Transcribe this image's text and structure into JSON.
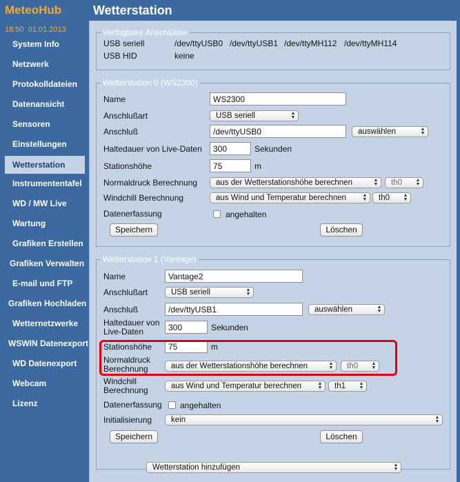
{
  "app": {
    "title": "MeteoHub",
    "time": "18:50",
    "date": "01.01.2013"
  },
  "nav": [
    "System Info",
    "Netzwerk",
    "Protokolldateien",
    "Datenansicht",
    "Sensoren",
    "Einstellungen",
    "Wetterstation",
    "Instrumententafel",
    "WD / MW Live",
    "Wartung",
    "Grafiken Erstellen",
    "Grafiken Verwalten",
    "E-mail und FTP",
    "Grafiken Hochladen",
    "Wetternetzwerke",
    "WSWIN Datenexport",
    "WD Datenexport",
    "Webcam",
    "Lizenz"
  ],
  "nav_active": "Wetterstation",
  "page_title": "Wetterstation",
  "ports": {
    "legend": "Verfügbare Anschlüsse",
    "usb_label": "USB seriell",
    "usb_values": [
      "/dev/ttyUSB0",
      "/dev/ttyUSB1",
      "/dev/ttyMH112",
      "/dev/ttyMH114"
    ],
    "hid_label": "USB HID",
    "hid_value": "keine"
  },
  "ws0": {
    "legend": "Wetterstation 0 (WS2300)",
    "name_label": "Name",
    "name_value": "WS2300",
    "type_label": "Anschlußart",
    "type_value": "USB seriell",
    "port_label": "Anschluß",
    "port_value": "/dev/ttyUSB0",
    "choose_label": "auswählen",
    "hold_label": "Haltedauer von Live-Daten",
    "hold_value": "300",
    "hold_unit": "Sekunden",
    "alt_label": "Stationshöhe",
    "alt_value": "75",
    "alt_unit": "m",
    "press_label": "Normaldruck Berechnung",
    "press_value": "aus der Wetterstationshöhe berechnen",
    "press_sensor": "th0",
    "wind_label": "Windchill Berechnung",
    "wind_value": "aus Wind und Temperatur berechnen",
    "wind_sensor": "th0",
    "capture_label": "Datenerfassung",
    "capture_option": "angehalten",
    "save_label": "Speichern",
    "delete_label": "Löschen"
  },
  "ws1": {
    "legend": "Wetterstation 1 (Vantage)",
    "name_label": "Name",
    "name_value": "Vantage2",
    "type_label": "Anschlußart",
    "type_value": "USB seriell",
    "port_label": "Anschluß",
    "port_value": "/dev/ttyUSB1",
    "choose_label": "auswählen",
    "hold_label_1": "Haltedauer von",
    "hold_label_2": "Live-Daten",
    "hold_value": "300",
    "hold_unit": "Sekunden",
    "alt_label": "Stationshöhe",
    "alt_value": "75",
    "alt_unit": "m",
    "press_label_1": "Normaldruck",
    "press_label_2": "Berechnung",
    "press_value": "aus der Wetterstationshöhe berechnen",
    "press_sensor": "th0",
    "wind_label_1": "Windchill",
    "wind_label_2": "Berechnung",
    "wind_value": "aus Wind und Temperatur berechnen",
    "wind_sensor": "th1",
    "capture_label": "Datenerfassung",
    "capture_option": "angehalten",
    "init_label": "Initialisierung",
    "init_value": "kein",
    "save_label": "Speichern",
    "delete_label": "Löschen"
  },
  "add_station": "Wetterstation hinzufügen",
  "colors": {
    "sidebar": "#3c6aa0",
    "content": "#c4d3e6",
    "logo": "#f2a92e",
    "highlight": "#e0000e"
  }
}
